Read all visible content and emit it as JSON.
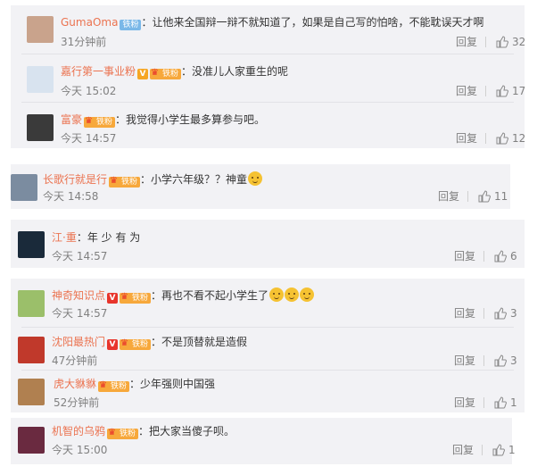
{
  "comments": [
    {
      "name": "GumaOma",
      "badges": [
        "fan-blue"
      ],
      "fan_label": "铁粉",
      "text": "：让他来全国辩一辩不就知道了，如果是自己写的怕啥，不能耽误天才啊",
      "emoji_count": 0,
      "time": "31分钟前",
      "reply": "回复",
      "likes": "32",
      "avatar_color": "#c9a38c"
    },
    {
      "name": "嘉行第一事业粉",
      "badges": [
        "v-gold",
        "fan"
      ],
      "fan_label": "铁粉",
      "text": "：没准儿人家重生的呢",
      "emoji_count": 0,
      "time": "今天 15:02",
      "reply": "回复",
      "likes": "17",
      "avatar_color": "#d8e3ef"
    },
    {
      "name": "富豪",
      "badges": [
        "fan"
      ],
      "fan_label": "铁粉",
      "text": "：我觉得小学生最多算参与吧。",
      "emoji_count": 0,
      "time": "今天 14:57",
      "reply": "回复",
      "likes": "12",
      "avatar_color": "#3a3a3a"
    },
    {
      "name": "长歌行就是行",
      "badges": [
        "fan"
      ],
      "fan_label": "铁粉",
      "text": "：小学六年级？？神童",
      "emoji_count": 1,
      "time": "今天 14:58",
      "reply": "回复",
      "likes": "11",
      "avatar_color": "#7b8ca0"
    },
    {
      "name": "江·重",
      "badges": [],
      "fan_label": "",
      "text": "：年 少 有 为",
      "emoji_count": 0,
      "time": "今天 14:57",
      "reply": "回复",
      "likes": "6",
      "avatar_color": "#1a2a3a"
    },
    {
      "name": "神奇知识点",
      "badges": [
        "v-red",
        "fan"
      ],
      "fan_label": "铁粉",
      "text": "：再也不看不起小学生了",
      "emoji_count": 3,
      "time": "今天 14:57",
      "reply": "回复",
      "likes": "3",
      "avatar_color": "#9bbf6a"
    },
    {
      "name": "沈阳最热门",
      "badges": [
        "v-red",
        "fan"
      ],
      "fan_label": "铁粉",
      "text": "：不是顶替就是造假",
      "emoji_count": 0,
      "time": "47分钟前",
      "reply": "回复",
      "likes": "3",
      "avatar_color": "#c0392b"
    },
    {
      "name": "虎大貅貅",
      "badges": [
        "fan"
      ],
      "fan_label": "铁粉",
      "text": "：少年强则中国强",
      "emoji_count": 0,
      "time": "52分钟前",
      "reply": "回复",
      "likes": "1",
      "avatar_color": "#b08050"
    },
    {
      "name": "机智的乌鸦",
      "badges": [
        "fan"
      ],
      "fan_label": "铁粉",
      "text": "：把大家当傻子呗。",
      "emoji_count": 0,
      "time": "今天 15:00",
      "reply": "回复",
      "likes": "1",
      "avatar_color": "#6a2a40"
    }
  ]
}
